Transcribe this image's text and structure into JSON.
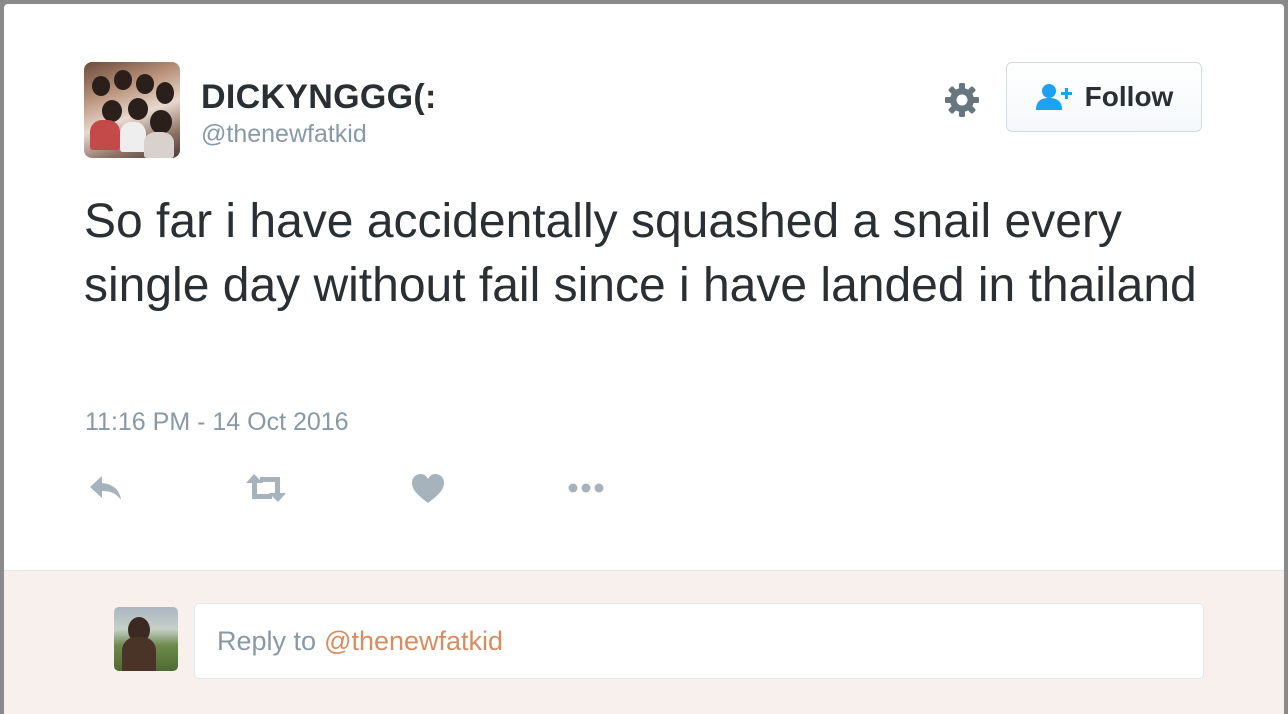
{
  "tweet": {
    "display_name": "DICKYNGGG(:",
    "handle": "@thenewfatkid",
    "text": "So far i have accidentally squashed a snail every single day without fail since i have landed in thailand",
    "timestamp": "11:16 PM - 14 Oct 2016"
  },
  "header": {
    "follow_label": "Follow",
    "settings_icon": "gear-icon",
    "follow_icon": "add-user-icon"
  },
  "actions": [
    {
      "name": "reply",
      "icon": "reply-icon"
    },
    {
      "name": "retweet",
      "icon": "retweet-icon"
    },
    {
      "name": "like",
      "icon": "heart-icon"
    },
    {
      "name": "more",
      "icon": "more-icon"
    }
  ],
  "reply": {
    "placeholder_prefix": "Reply to",
    "placeholder_handle": "@thenewfatkid"
  },
  "colors": {
    "text": "#292f33",
    "muted": "#8899a6",
    "accent": "#1da1f2",
    "reply_handle": "#d98c5f",
    "reply_bg": "#f8f0ec"
  }
}
